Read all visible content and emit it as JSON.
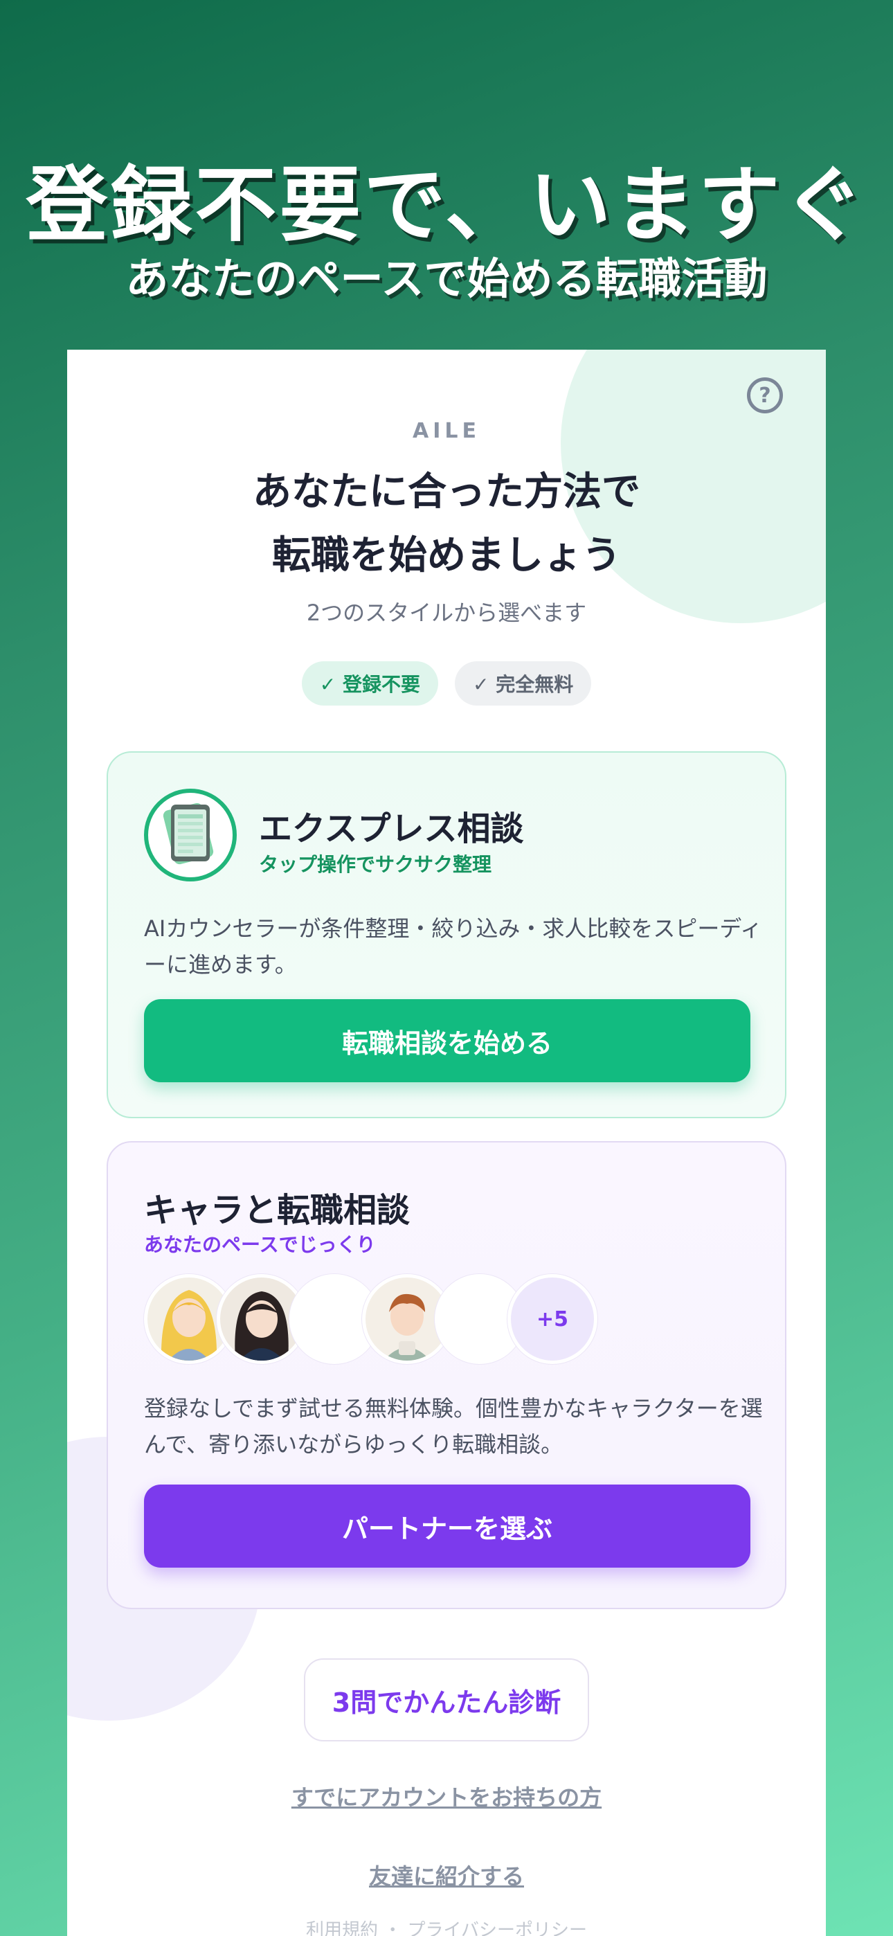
{
  "hero": {
    "title": "登録不要で、いますぐ",
    "subtitle": "あなたのペースで始める転職活動"
  },
  "card": {
    "help_icon": "?",
    "brand": "AILE",
    "headline_line1": "あなたに合った方法で",
    "headline_line2": "転職を始めましょう",
    "subline": "2つのスタイルから選べます",
    "chips": [
      {
        "label": "✓ 登録不要"
      },
      {
        "label": "✓ 完全無料"
      }
    ]
  },
  "express": {
    "icon": "tablet-icon",
    "title": "エクスプレス相談",
    "tag": "タップ操作でサクサク整理",
    "description": "AIカウンセラーが条件整理・絞り込み・求人比較をスピーディーに進めます。",
    "button": "転職相談を始める"
  },
  "chara": {
    "title": "キャラと転職相談",
    "tag": "あなたのペースでじっくり",
    "more_count": "+5",
    "description": "登録なしでまず試せる無料体験。個性豊かなキャラクターを選んで、寄り添いながらゆっくり転職相談。",
    "button": "パートナーを選ぶ"
  },
  "diagnosis_button": "3問でかんたん診断",
  "links": {
    "login": "すでにアカウントをお持ちの方",
    "refer": "友達に紹介する"
  },
  "footer": "利用規約 ・ プライバシーポリシー",
  "colors": {
    "green_accent": "#12bb80",
    "purple_accent": "#7c3aed"
  }
}
